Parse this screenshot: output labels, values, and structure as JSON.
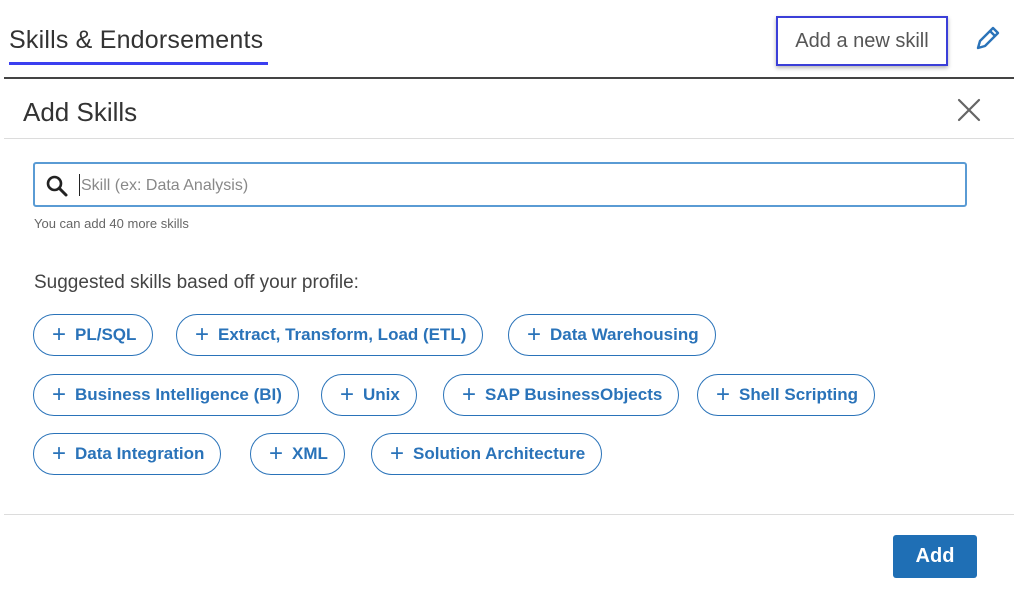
{
  "section": {
    "title": "Skills & Endorsements",
    "add_new_skill_label": "Add a new skill"
  },
  "modal": {
    "title": "Add Skills",
    "search": {
      "value": "",
      "placeholder": "Skill (ex: Data Analysis)",
      "helper": "You can add 40 more skills"
    },
    "suggested_label": "Suggested skills based off your profile:",
    "suggested_skills": [
      "PL/SQL",
      "Extract, Transform, Load (ETL)",
      "Data Warehousing",
      "Business Intelligence (BI)",
      "Unix",
      "SAP BusinessObjects",
      "Shell Scripting",
      "Data Integration",
      "XML",
      "Solution Architecture"
    ],
    "add_button_label": "Add"
  },
  "colors": {
    "accent": "#2a73b9",
    "primary_button": "#1f6fb5",
    "highlight_box": "#3b3fd8"
  },
  "icons": {
    "edit": "pencil-icon",
    "close": "close-icon",
    "search": "search-icon",
    "plus": "plus-icon"
  }
}
